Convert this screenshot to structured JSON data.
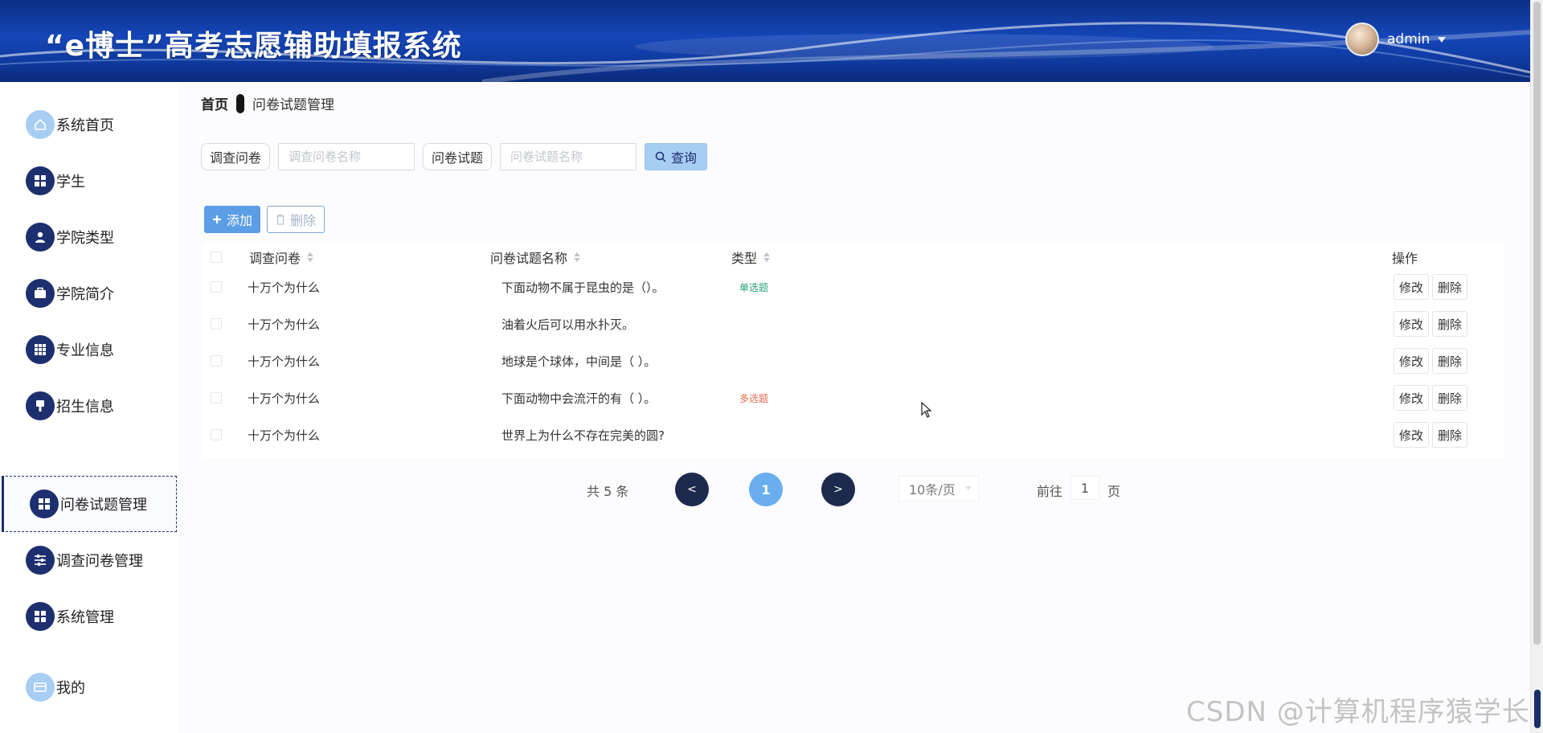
{
  "app": {
    "title": "“e博士”高考志愿辅助填报系统",
    "user": "admin"
  },
  "sidebar": {
    "items": [
      {
        "label": "系统首页",
        "icon": "home-icon"
      },
      {
        "label": "学生",
        "icon": "grid-icon"
      },
      {
        "label": "学院类型",
        "icon": "user-icon"
      },
      {
        "label": "学院简介",
        "icon": "briefcase-icon"
      },
      {
        "label": "专业信息",
        "icon": "table-icon"
      },
      {
        "label": "招生信息",
        "icon": "brush-icon"
      },
      {
        "label": "问卷试题管理",
        "icon": "grid-icon",
        "active": true
      },
      {
        "label": "调查问卷管理",
        "icon": "sliders-icon"
      },
      {
        "label": "系统管理",
        "icon": "grid-icon"
      },
      {
        "label": "我的",
        "icon": "card-icon"
      }
    ]
  },
  "breadcrumb": {
    "home": "首页",
    "current": "问卷试题管理"
  },
  "search": {
    "field1_label": "调查问卷",
    "field1_placeholder": "调查问卷名称",
    "field2_label": "问卷试题",
    "field2_placeholder": "问卷试题名称",
    "query_label": "查询"
  },
  "toolbar": {
    "add_label": "添加",
    "delete_label": "删除"
  },
  "table": {
    "headers": {
      "survey": "调查问卷",
      "question": "问卷试题名称",
      "type": "类型",
      "ops": "操作"
    },
    "rows": [
      {
        "survey": "十万个为什么",
        "question": "下面动物不属于昆虫的是（）。",
        "type": "单选题"
      },
      {
        "survey": "十万个为什么",
        "question": "油着火后可以用水扑灭。",
        "type": ""
      },
      {
        "survey": "十万个为什么",
        "question": "地球是个球体，中间是（ ）。",
        "type": ""
      },
      {
        "survey": "十万个为什么",
        "question": "下面动物中会流汗的有（ ）。",
        "type": "多选题"
      },
      {
        "survey": "十万个为什么",
        "question": "世界上为什么不存在完美的圆?",
        "type": ""
      }
    ],
    "edit_label": "修改",
    "delete_label": "删除"
  },
  "pagination": {
    "total": "共 5 条",
    "prev": "<",
    "page": "1",
    "next": ">",
    "page_size": "10条/页",
    "goto_label": "前往",
    "goto_value": "1",
    "goto_suffix": "页"
  },
  "watermark": "CSDN @计算机程序猿学长",
  "colors": {
    "primary": "#1d2f6e",
    "accent": "#6aaef0",
    "single": "#27a178",
    "multi": "#e06a4a"
  }
}
